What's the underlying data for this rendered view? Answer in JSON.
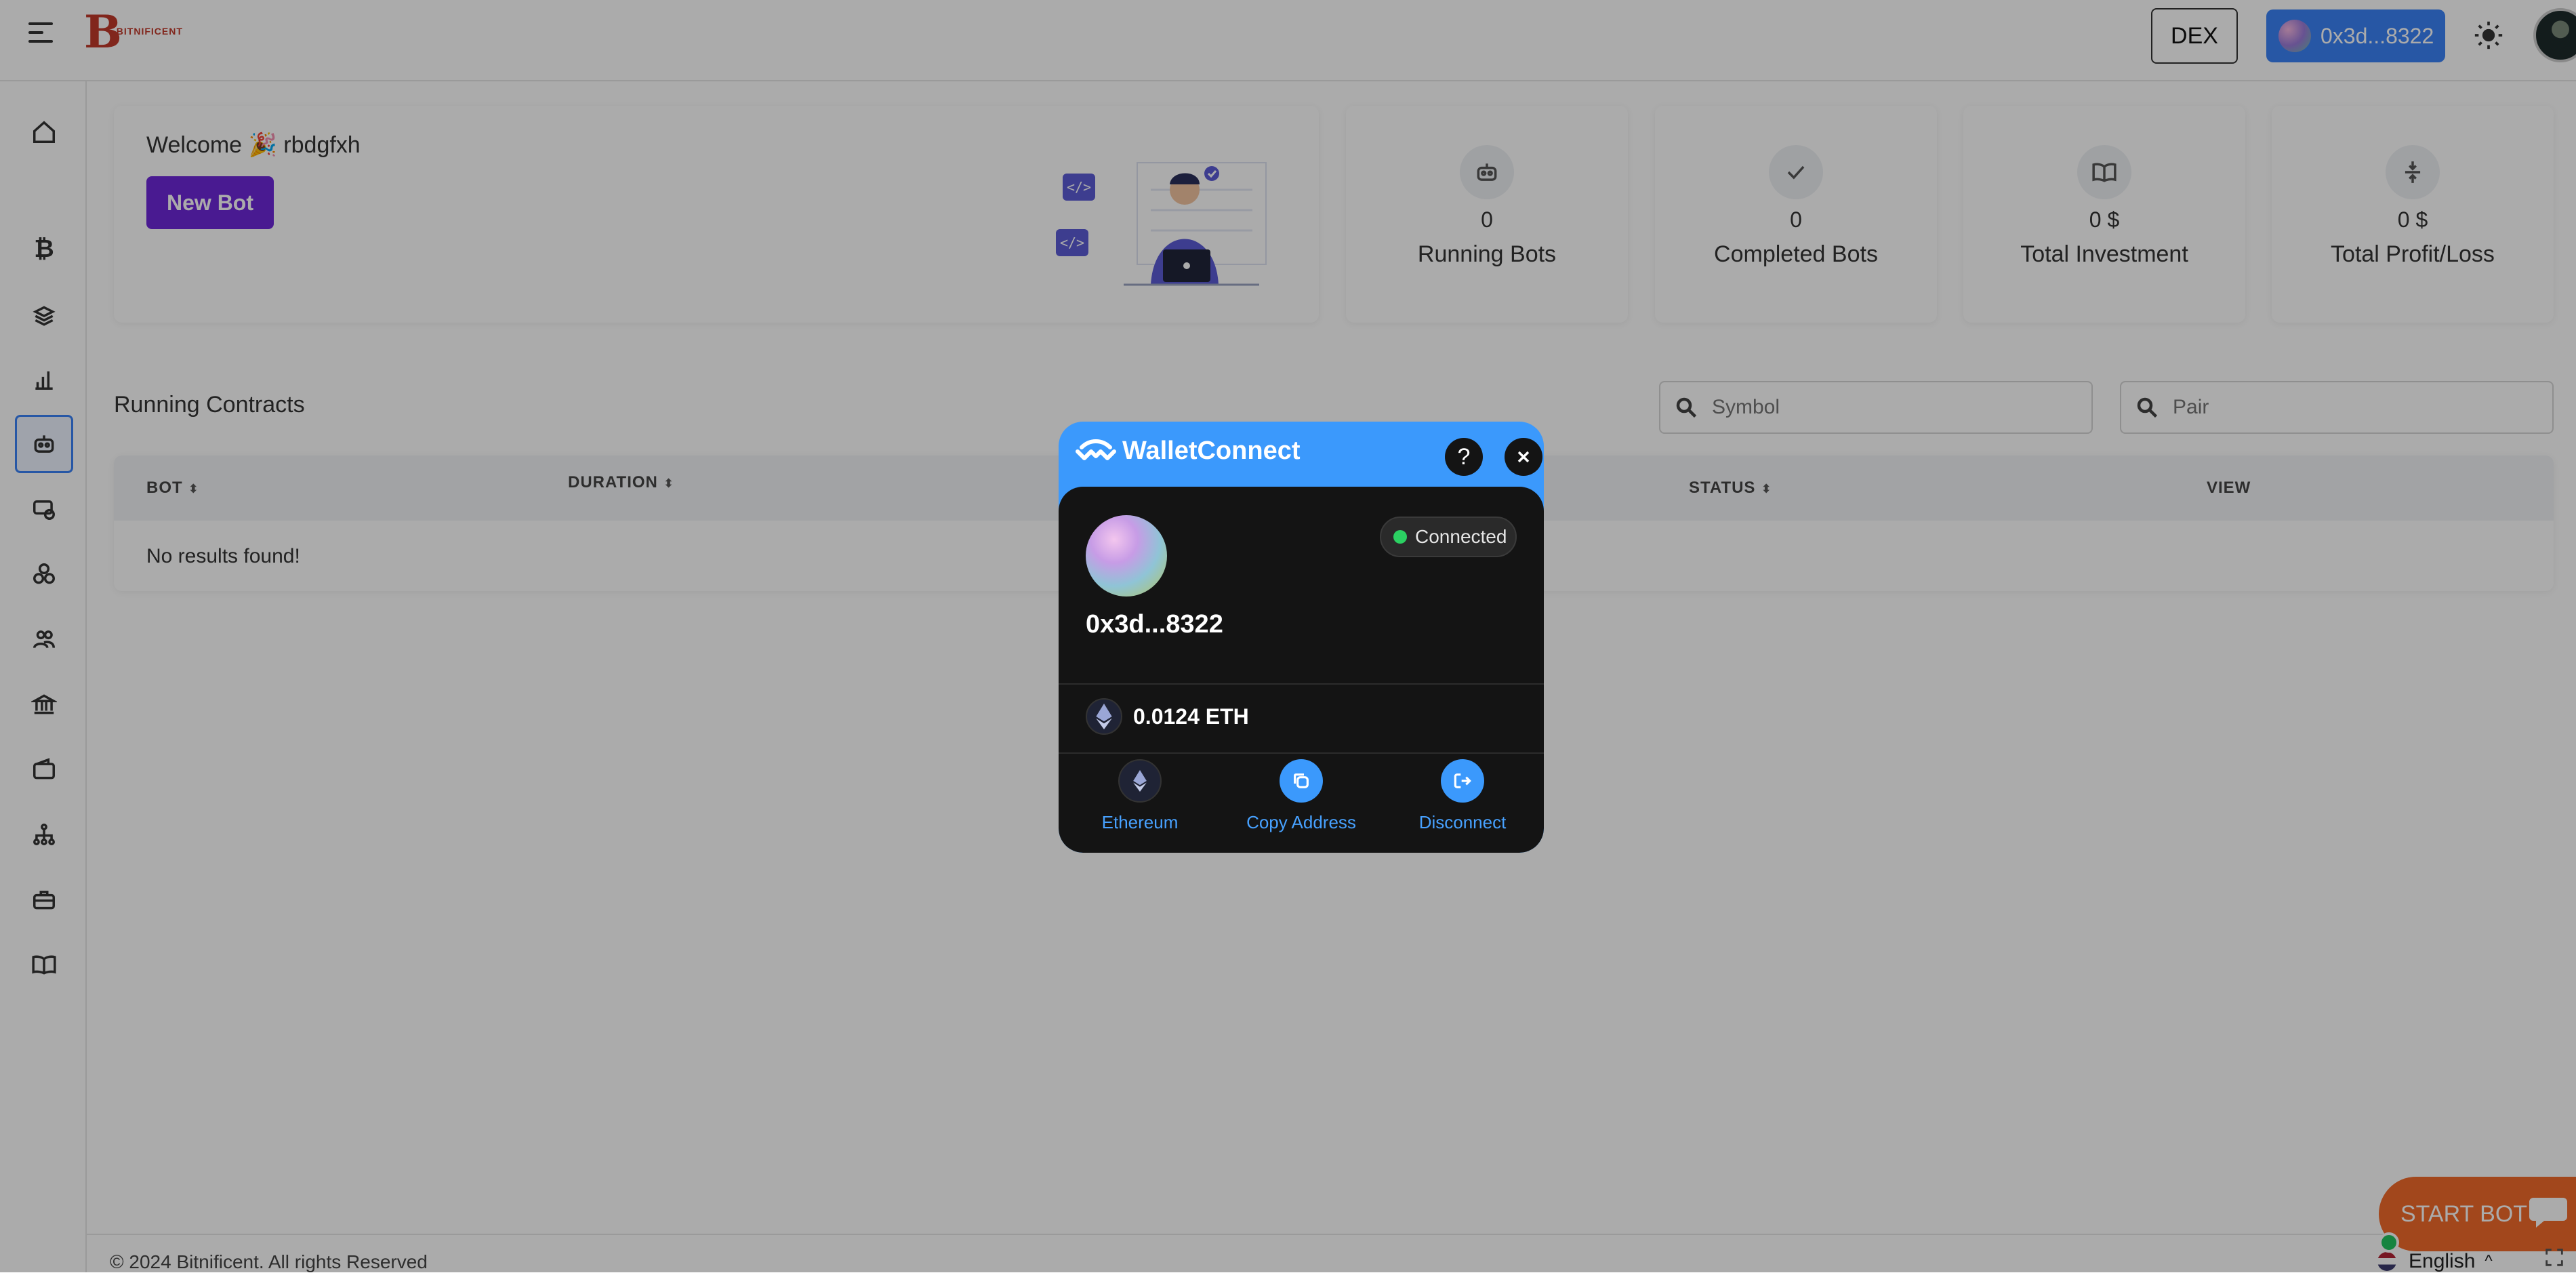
{
  "header": {
    "dex_label": "DEX",
    "account_label": "0x3d...8322",
    "logo_text": "BITNIFICENT"
  },
  "welcome": {
    "greeting": "Welcome 🎉 rbdgfxh",
    "new_bot_label": "New Bot"
  },
  "stats": [
    {
      "value": "0",
      "label": "Running Bots",
      "icon": "robot-icon"
    },
    {
      "value": "0",
      "label": "Completed Bots",
      "icon": "check-icon"
    },
    {
      "value": "0 $",
      "label": "Total Investment",
      "icon": "book-icon"
    },
    {
      "value": "0 $",
      "label": "Total Profit/Loss",
      "icon": "arrows-vertical-icon"
    }
  ],
  "contracts": {
    "title": "Running Contracts",
    "symbol_placeholder": "Symbol",
    "pair_placeholder": "Pair",
    "columns": [
      "BOT",
      "DURATION",
      "STATUS",
      "VIEW"
    ],
    "empty_text": "No results found!"
  },
  "footer": {
    "copyright": "© 2024 Bitnificent. All rights Reserved",
    "language": "English"
  },
  "start_bot_label": "START BOT",
  "wallet_modal": {
    "brand": "WalletConnect",
    "help_label": "?",
    "status": "Connected",
    "address": "0x3d...8322",
    "balance": "0.0124 ETH",
    "actions": [
      {
        "label": "Ethereum",
        "icon": "ethereum-icon"
      },
      {
        "label": "Copy Address",
        "icon": "copy-icon"
      },
      {
        "label": "Disconnect",
        "icon": "disconnect-icon"
      }
    ]
  },
  "colors": {
    "accent_purple": "#6d28d9",
    "account_blue": "#3b82f6",
    "walletconnect_blue": "#3b99fc",
    "start_bot_orange": "#f26b2a",
    "connected_green": "#2bee6c"
  }
}
